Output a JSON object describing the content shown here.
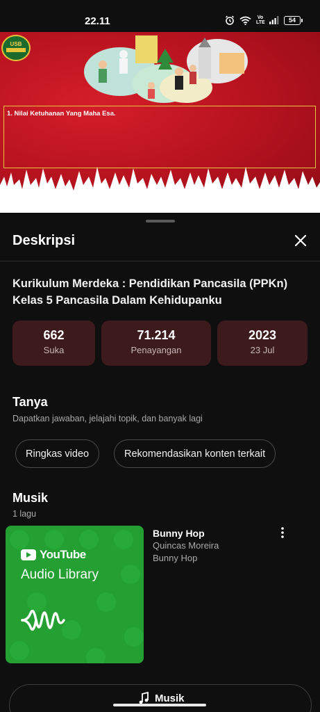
{
  "status_bar": {
    "time": "22.11",
    "network_label": "Vo LTE",
    "battery": "54"
  },
  "video": {
    "logo_text": "USB EDUCATION CHANNEL",
    "box_text": "1. Nilai Ketuhanan Yang Maha Esa."
  },
  "description_sheet": {
    "title": "Deskripsi",
    "video_title": "Kurikulum Merdeka : Pendidikan Pancasila (PPKn) Kelas 5 Pancasila Dalam Kehidupanku",
    "stats": [
      {
        "value": "662",
        "label": "Suka"
      },
      {
        "value": "71.214",
        "label": "Penayangan"
      },
      {
        "value": "2023",
        "label": "23 Jul"
      }
    ],
    "ask": {
      "title": "Tanya",
      "subtitle": "Dapatkan jawaban, jelajahi topik, dan banyak lagi",
      "chips": [
        "Ringkas video",
        "Rekomendasikan konten terkait"
      ]
    },
    "music": {
      "title": "Musik",
      "count": "1 lagu",
      "album_brand": "YouTube",
      "album_label": "Audio Library",
      "track": {
        "title": "Bunny Hop",
        "artist": "Quincas Moreira",
        "album": "Bunny Hop"
      },
      "button_label": "Musik"
    }
  },
  "colors": {
    "background": "#0f0f0f",
    "stat_card": "#3d1a1c",
    "video_red": "#b3121e",
    "album_green": "#24a033",
    "accent_gold": "#e8c640"
  }
}
